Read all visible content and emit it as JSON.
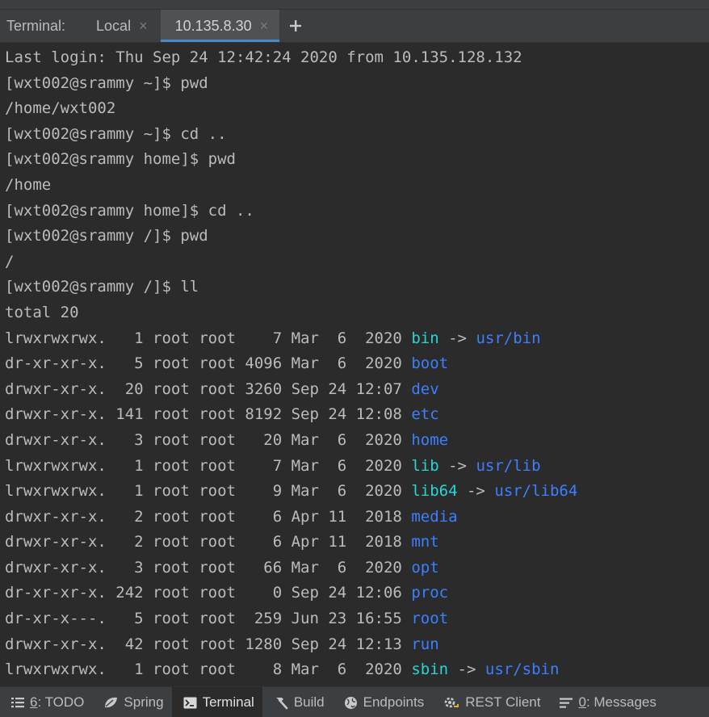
{
  "tab_bar": {
    "label": "Terminal:",
    "tabs": [
      {
        "label": "Local",
        "active": false
      },
      {
        "label": "10.135.8.30",
        "active": true
      }
    ],
    "add_label": "+"
  },
  "terminal": {
    "lines": [
      "Last login: Thu Sep 24 12:42:24 2020 from 10.135.128.132",
      "[wxt002@srammy ~]$ pwd",
      "/home/wxt002",
      "[wxt002@srammy ~]$ cd ..",
      "[wxt002@srammy home]$ pwd",
      "/home",
      "[wxt002@srammy home]$ cd ..",
      "[wxt002@srammy /]$ pwd",
      "/",
      "[wxt002@srammy /]$ ll",
      "total 20"
    ],
    "listing": [
      {
        "info": "lrwxrwxrwx.   1 root root    7 Mar  6  2020 ",
        "name": "bin",
        "type": "link",
        "target": "usr/bin"
      },
      {
        "info": "dr-xr-xr-x.   5 root root 4096 Mar  6  2020 ",
        "name": "boot",
        "type": "dir"
      },
      {
        "info": "drwxr-xr-x.  20 root root 3260 Sep 24 12:07 ",
        "name": "dev",
        "type": "dir"
      },
      {
        "info": "drwxr-xr-x. 141 root root 8192 Sep 24 12:08 ",
        "name": "etc",
        "type": "dir"
      },
      {
        "info": "drwxr-xr-x.   3 root root   20 Mar  6  2020 ",
        "name": "home",
        "type": "dir"
      },
      {
        "info": "lrwxrwxrwx.   1 root root    7 Mar  6  2020 ",
        "name": "lib",
        "type": "link",
        "target": "usr/lib"
      },
      {
        "info": "lrwxrwxrwx.   1 root root    9 Mar  6  2020 ",
        "name": "lib64",
        "type": "link",
        "target": "usr/lib64"
      },
      {
        "info": "drwxr-xr-x.   2 root root    6 Apr 11  2018 ",
        "name": "media",
        "type": "dir"
      },
      {
        "info": "drwxr-xr-x.   2 root root    6 Apr 11  2018 ",
        "name": "mnt",
        "type": "dir"
      },
      {
        "info": "drwxr-xr-x.   3 root root   66 Mar  6  2020 ",
        "name": "opt",
        "type": "dir"
      },
      {
        "info": "dr-xr-xr-x. 242 root root    0 Sep 24 12:06 ",
        "name": "proc",
        "type": "dir"
      },
      {
        "info": "dr-xr-x---.   5 root root  259 Jun 23 16:55 ",
        "name": "root",
        "type": "dir"
      },
      {
        "info": "drwxr-xr-x.  42 root root 1280 Sep 24 12:13 ",
        "name": "run",
        "type": "dir"
      },
      {
        "info": "lrwxrwxrwx.   1 root root    8 Mar  6  2020 ",
        "name": "sbin",
        "type": "link",
        "target": "usr/sbin"
      }
    ],
    "arrow": "->"
  },
  "statusbar": {
    "tools": [
      {
        "mnemonic": "6",
        "label": ": TODO",
        "icon": "list-icon",
        "active": false
      },
      {
        "mnemonic": "",
        "label": "Spring",
        "icon": "spring-leaf-icon",
        "active": false
      },
      {
        "mnemonic": "",
        "label": "Terminal",
        "icon": "terminal-icon",
        "active": true
      },
      {
        "mnemonic": "",
        "label": "Build",
        "icon": "hammer-icon",
        "active": false
      },
      {
        "mnemonic": "",
        "label": "Endpoints",
        "icon": "globe-icon",
        "active": false
      },
      {
        "mnemonic": "",
        "label": "REST Client",
        "icon": "rest-client-icon",
        "active": false
      },
      {
        "mnemonic": "0",
        "label": ": Messages",
        "icon": "messages-icon",
        "active": false
      }
    ]
  },
  "colors": {
    "background": "#2b2b2b",
    "text": "#bbbbbb",
    "directory": "#3c7fff",
    "symlink": "#28d5d5",
    "accent": "#4a88c7"
  }
}
